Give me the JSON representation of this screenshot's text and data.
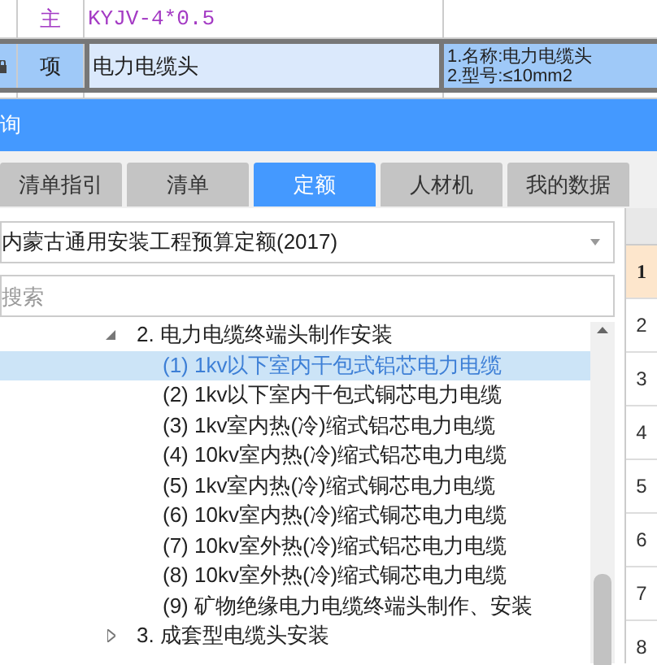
{
  "grid_rows": [
    {
      "type": "主",
      "name": "KYJV-4*0.5",
      "description": [],
      "locked": false,
      "selected": false
    },
    {
      "type": "项",
      "name": "电力电缆头",
      "description": [
        "1.名称:电力电缆头",
        "2.型号:≤10mm2"
      ],
      "locked": true,
      "selected": true
    }
  ],
  "panel_title": "询",
  "tabs": [
    {
      "label": "清单指引",
      "selected": false
    },
    {
      "label": "清单",
      "selected": false
    },
    {
      "label": "定额",
      "selected": true
    },
    {
      "label": "人材机",
      "selected": false
    },
    {
      "label": "我的数据",
      "selected": false
    }
  ],
  "library_select": {
    "value": "内蒙古通用安装工程预算定额(2017)"
  },
  "search": {
    "placeholder": "搜索"
  },
  "tree": [
    {
      "label": "2. 电力电缆终端头制作安装",
      "expanded": true,
      "selected": false,
      "children": [
        {
          "label": "(1) 1kv以下室内干包式铝芯电力电缆",
          "selected": true
        },
        {
          "label": "(2) 1kv以下室内干包式铜芯电力电缆",
          "selected": false
        },
        {
          "label": "(3) 1kv室内热(冷)缩式铝芯电力电缆",
          "selected": false
        },
        {
          "label": "(4) 10kv室内热(冷)缩式铝芯电力电缆",
          "selected": false
        },
        {
          "label": "(5) 1kv室内热(冷)缩式铜芯电力电缆",
          "selected": false
        },
        {
          "label": "(6) 10kv室内热(冷)缩式铜芯电力电缆",
          "selected": false
        },
        {
          "label": "(7) 10kv室外热(冷)缩式铝芯电力电缆",
          "selected": false
        },
        {
          "label": "(8) 10kv室外热(冷)缩式铜芯电力电缆",
          "selected": false
        },
        {
          "label": "(9) 矿物绝缘电力电缆终端头制作、安装",
          "selected": false
        }
      ]
    },
    {
      "label": "3. 成套型电缆头安装",
      "expanded": false,
      "selected": false
    }
  ],
  "row_numbers": [
    {
      "label": "1",
      "selected": true
    },
    {
      "label": "2",
      "selected": false
    },
    {
      "label": "3",
      "selected": false
    },
    {
      "label": "4",
      "selected": false
    },
    {
      "label": "5",
      "selected": false
    },
    {
      "label": "6",
      "selected": false
    },
    {
      "label": "7",
      "selected": false
    },
    {
      "label": "8",
      "selected": false
    }
  ]
}
